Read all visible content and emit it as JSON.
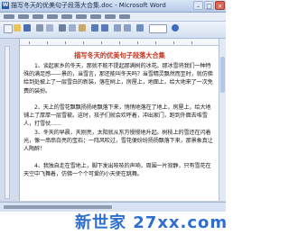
{
  "window": {
    "title": "描写冬天的优美句子段落大合集.doc - Microsoft Word",
    "buttons": {
      "minimize": "–",
      "maximize": "□",
      "close": "×"
    }
  },
  "document": {
    "title": "描写冬天的优美句子段落大合集",
    "paragraphs": [
      "　　1、谈起家乡的冬天，那就不能不提起那满树的冰花。那冰雪将我们一种特殊的满足感——景的，当雪言，那还能叫冬天吗？当雪精灵飘然而至时，就仿佛给到处披上了一层雪白的新装，落在树上，房屋上，地面上，给大地来了一次免费的装扮。",
      "　　2、天上的雪花飘飘扬扬地飘落下来，悄悄地落在了地上，房屋上，给大地铺上了厚厚一层雪被。这时，孩子们就会欢呼着，冲出家门，跑到外面去堆雪人，打雪仗……",
      "　　3、冬天的早晨，天刚亮，太阳就从东方慢慢地升起。树枝上的雪还在闪着光，像一串串白亮的宝石；一阵风吹过，雪花便纷纷扬扬飘落下来，那景象真让人陶醉！",
      "　　4、我独自走在雪地上，脚下发出吱吱的声响，周围一片寂静，只有雪花在天空中飞舞着，仿佛一个个可爱的小天使在跳舞。"
    ]
  },
  "watermark": "新世家 27xx.com"
}
